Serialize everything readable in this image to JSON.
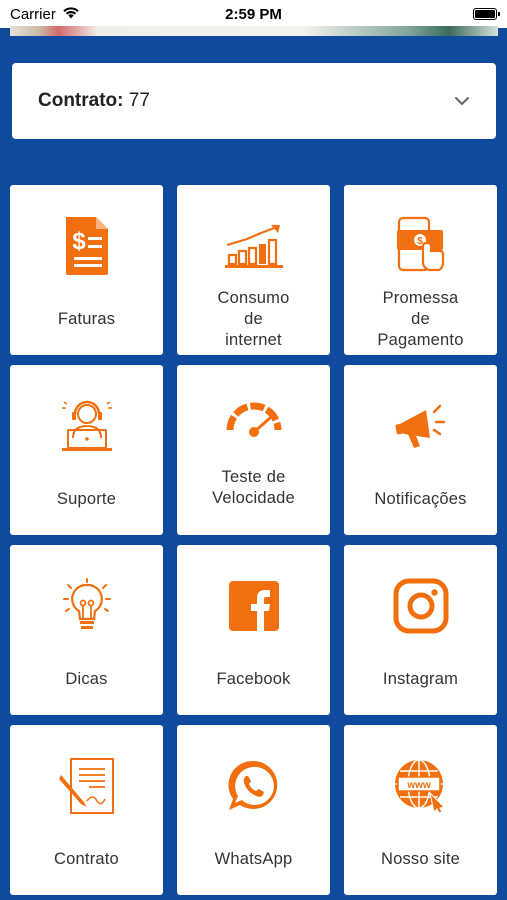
{
  "status_bar": {
    "carrier": "Carrier",
    "time": "2:59 PM"
  },
  "contract": {
    "label": "Contrato:",
    "value": "77"
  },
  "colors": {
    "background": "#0f4a9e",
    "accent": "#f26f0f",
    "tile": "#ffffff"
  },
  "tiles": [
    {
      "label": "Faturas",
      "icon": "invoice-icon"
    },
    {
      "label": "Consumo\nde\ninternet",
      "icon": "bar-chart-icon"
    },
    {
      "label": "Promessa\nde\nPagamento",
      "icon": "payment-phone-icon"
    },
    {
      "label": "Suporte",
      "icon": "support-agent-icon"
    },
    {
      "label": "Teste de\nVelocidade",
      "icon": "speedometer-icon"
    },
    {
      "label": "Notificações",
      "icon": "megaphone-icon"
    },
    {
      "label": "Dicas",
      "icon": "lightbulb-icon"
    },
    {
      "label": "Facebook",
      "icon": "facebook-icon"
    },
    {
      "label": "Instagram",
      "icon": "instagram-icon"
    },
    {
      "label": "Contrato",
      "icon": "contract-document-icon"
    },
    {
      "label": "WhatsApp",
      "icon": "whatsapp-icon"
    },
    {
      "label": "Nosso site",
      "icon": "website-globe-icon"
    }
  ]
}
